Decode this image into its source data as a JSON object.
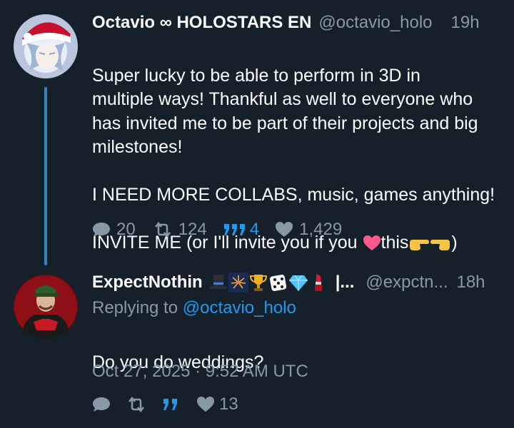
{
  "tweet1": {
    "name": "Octavio ∞ HOLOSTARS EN",
    "handle": "@octavio_holo",
    "time": "19h",
    "body_main": "Super lucky to be able to perform in 3D in\nmultiple ways! Thankful as well to everyone who\nhas invited me to be part of their projects and big\nmilestones!\n\nI NEED MORE COLLABS, music, games anything!",
    "body_last_prefix": "INVITE ME (or I'll invite you if you ",
    "body_last_word": "this",
    "body_last_suffix": ")",
    "replies": "20",
    "retweets": "124",
    "quotes": "4",
    "likes": "1,429",
    "avatar_icon": "avatar-icon"
  },
  "tweet2": {
    "name": "ExpectNothin",
    "name_truncation": "|...",
    "handle": "@expctn...",
    "time": "18h",
    "replying_prefix": "Replying to ",
    "replying_handle": "@octavio_holo",
    "body": "Do you do weddings?",
    "timestamp": "Oct 27, 2025 · 9:52 AM UTC",
    "likes": "13",
    "name_emojis": [
      "top-hat-icon",
      "fireworks-icon",
      "trophy-icon",
      "dice-icon",
      "gem-icon",
      "lipstick-icon"
    ]
  },
  "colors": {
    "background": "#15202b",
    "secondary_text": "#8899a6",
    "accent": "#1d9bf0",
    "thread_line": "#3a7fc4"
  }
}
